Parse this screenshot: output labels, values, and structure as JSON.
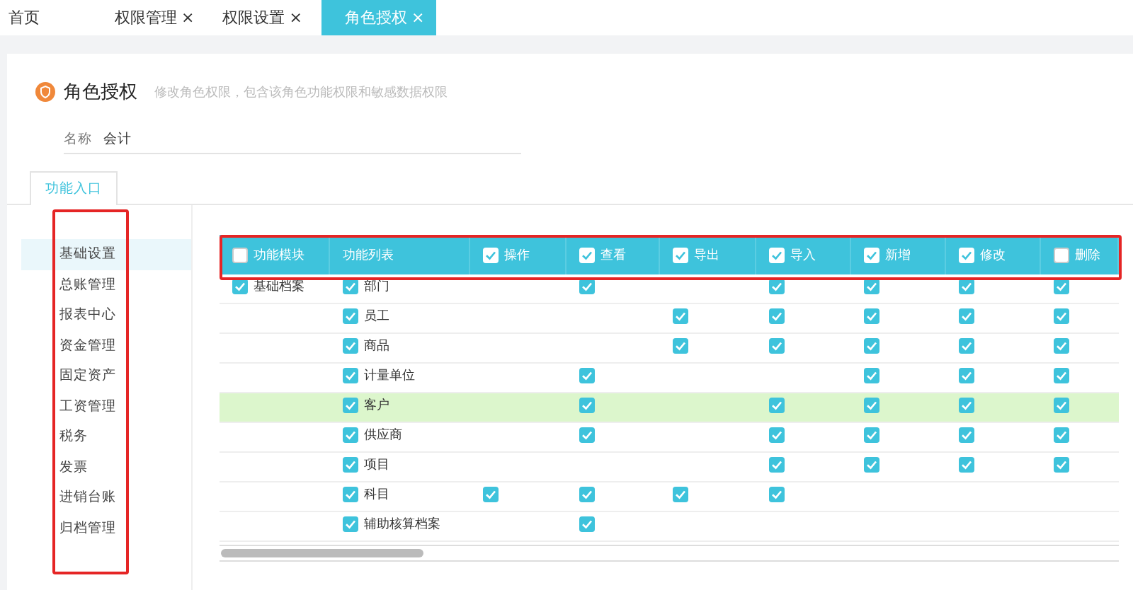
{
  "tabs": [
    {
      "label": "首页",
      "selected": false
    },
    {
      "label": "权限管理",
      "close": "×",
      "selected": false
    },
    {
      "label": "权限设置",
      "close": "×",
      "selected": false
    },
    {
      "label": "角色授权",
      "close": "×",
      "selected": true
    }
  ],
  "page": {
    "title": "角色授权",
    "subtitle": "修改角色权限，包含该角色功能权限和敏感数据权限"
  },
  "name_field": {
    "label": "名称",
    "value": "会计"
  },
  "section_tabs": [
    {
      "label": "功能入口",
      "selected": true
    }
  ],
  "sidebar": {
    "items": [
      {
        "label": "基础设置",
        "selected": true
      },
      {
        "label": "总账管理",
        "selected": false
      },
      {
        "label": "报表中心",
        "selected": false
      },
      {
        "label": "资金管理",
        "selected": false
      },
      {
        "label": "固定资产",
        "selected": false
      },
      {
        "label": "工资管理",
        "selected": false
      },
      {
        "label": "税务",
        "selected": false
      },
      {
        "label": "发票",
        "selected": false
      },
      {
        "label": "进销台账",
        "selected": false
      },
      {
        "label": "归档管理",
        "selected": false
      }
    ]
  },
  "table": {
    "columns": [
      {
        "label": "功能模块",
        "checked": false
      },
      {
        "label": "功能列表"
      },
      {
        "label": "操作",
        "checked": true
      },
      {
        "label": "查看",
        "checked": true
      },
      {
        "label": "导出",
        "checked": true
      },
      {
        "label": "导入",
        "checked": true
      },
      {
        "label": "新增",
        "checked": true
      },
      {
        "label": "修改",
        "checked": true
      },
      {
        "label": "删除",
        "checked": false
      }
    ],
    "rows": [
      {
        "module": {
          "label": "基础档案",
          "checked": true
        },
        "function": {
          "label": "部门",
          "checked": true
        },
        "permissions": [
          false,
          true,
          false,
          true,
          true,
          true,
          true
        ],
        "selected": false
      },
      {
        "function": {
          "label": "员工",
          "checked": true
        },
        "permissions": [
          false,
          false,
          true,
          true,
          true,
          true,
          true
        ],
        "selected": false
      },
      {
        "function": {
          "label": "商品",
          "checked": true
        },
        "permissions": [
          false,
          false,
          true,
          true,
          true,
          true,
          true
        ],
        "selected": false
      },
      {
        "function": {
          "label": "计量单位",
          "checked": true
        },
        "permissions": [
          false,
          true,
          false,
          false,
          true,
          true,
          true
        ],
        "selected": false
      },
      {
        "function": {
          "label": "客户",
          "checked": true
        },
        "permissions": [
          false,
          true,
          false,
          true,
          true,
          true,
          true
        ],
        "selected": true
      },
      {
        "function": {
          "label": "供应商",
          "checked": true
        },
        "permissions": [
          false,
          true,
          false,
          true,
          true,
          true,
          true
        ],
        "selected": false
      },
      {
        "function": {
          "label": "项目",
          "checked": true
        },
        "permissions": [
          false,
          false,
          false,
          true,
          true,
          true,
          true
        ],
        "selected": false
      },
      {
        "function": {
          "label": "科目",
          "checked": true
        },
        "permissions": [
          true,
          true,
          true,
          true,
          false,
          false,
          false
        ],
        "selected": false
      },
      {
        "function": {
          "label": "辅助核算档案",
          "checked": true
        },
        "permissions": [
          false,
          true,
          false,
          false,
          false,
          false,
          false
        ],
        "selected": false
      }
    ]
  }
}
